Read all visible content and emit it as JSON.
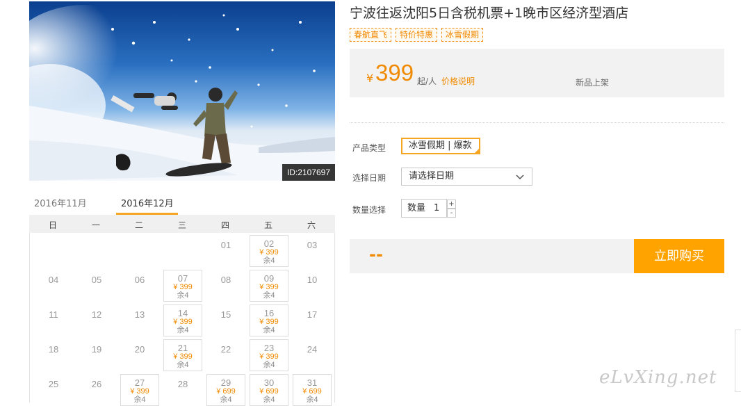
{
  "product": {
    "title": "宁波往返沈阳5日含税机票+1晚市区经济型酒店",
    "image_id": "ID:2107697",
    "tags": [
      "春航直飞",
      "特价特惠",
      "冰雪假期"
    ]
  },
  "price": {
    "currency": "¥",
    "amount": "399",
    "unit": "起/人",
    "note_link": "价格说明",
    "status": "新品上架"
  },
  "form": {
    "type_label": "产品类型",
    "type_value": "冰雪假期 | 爆款",
    "date_label": "选择日期",
    "date_placeholder": "请选择日期",
    "qty_label": "数量选择",
    "qty_field_label": "数量",
    "qty_value": "1",
    "plus": "+",
    "minus": "-"
  },
  "buy": {
    "total": "--",
    "button": "立即购买"
  },
  "calendar": {
    "months": [
      "2016年11月",
      "2016年12月"
    ],
    "weekdays": [
      "日",
      "一",
      "二",
      "三",
      "四",
      "五",
      "六"
    ],
    "rows": [
      [
        "",
        "",
        "",
        "",
        "01",
        {
          "d": "02",
          "p": "¥ 399",
          "r": "余4"
        },
        "03"
      ],
      [
        "04",
        "05",
        "06",
        {
          "d": "07",
          "p": "¥ 399",
          "r": "余4"
        },
        "08",
        {
          "d": "09",
          "p": "¥ 399",
          "r": "余4"
        },
        "10"
      ],
      [
        "11",
        "12",
        "13",
        {
          "d": "14",
          "p": "¥ 399",
          "r": "余4"
        },
        "15",
        {
          "d": "16",
          "p": "¥ 399",
          "r": "余4"
        },
        "17"
      ],
      [
        "18",
        "19",
        "20",
        {
          "d": "21",
          "p": "¥ 399",
          "r": "余4"
        },
        "22",
        {
          "d": "23",
          "p": "¥ 399",
          "r": "余4"
        },
        "24"
      ],
      [
        "25",
        "26",
        {
          "d": "27",
          "p": "¥ 399",
          "r": "余4"
        },
        "28",
        {
          "d": "29",
          "p": "¥ 699",
          "r": "余4"
        },
        {
          "d": "30",
          "p": "¥ 699",
          "r": "余4"
        },
        {
          "d": "31",
          "p": "¥ 699",
          "r": "余4"
        }
      ]
    ]
  },
  "watermark": "eLvXing.net",
  "colors": {
    "accent": "#f08a00",
    "button": "#ffa300",
    "border_active": "#f5a623"
  }
}
